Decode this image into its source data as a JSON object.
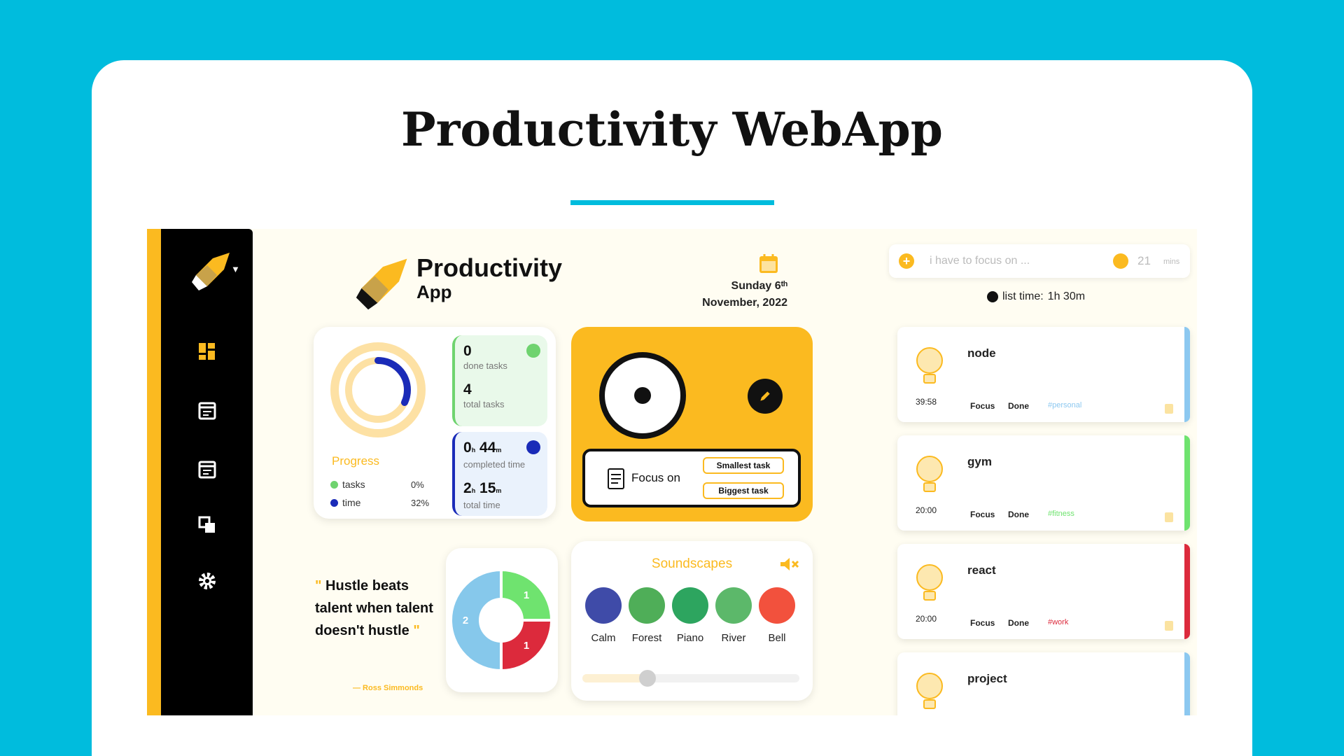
{
  "page": {
    "headline": "Productivity WebApp"
  },
  "brand": {
    "title": "Productivity",
    "subtitle": "App"
  },
  "date": {
    "line1": "Sunday 6ᵗʰ",
    "line2": "November, 2022"
  },
  "focus_bar": {
    "placeholder": "i have to focus on ...",
    "minutes": "21",
    "unit": "mins"
  },
  "list_time": {
    "label": "list time:",
    "value": "1h 30m"
  },
  "progress": {
    "title": "Progress",
    "legend": [
      {
        "label": "tasks",
        "value": "0%",
        "color": "#6FD36F"
      },
      {
        "label": "time",
        "value": "32%",
        "color": "#1A2BB8"
      }
    ],
    "time_fraction": 0.32,
    "done_tasks": {
      "value": "0",
      "label": "done tasks"
    },
    "total_tasks": {
      "value": "4",
      "label": "total tasks"
    },
    "completed_time": {
      "h": "0",
      "m": "44",
      "label": "completed time"
    },
    "total_time": {
      "h": "2",
      "m": "15",
      "label": "total time"
    }
  },
  "timer": {
    "focus_label": "Focus on",
    "smallest_label": "Smallest task",
    "biggest_label": "Biggest task"
  },
  "quote": {
    "open": "\"",
    "text": "Hustle beats talent when talent doesn't hustle",
    "close": "\"",
    "author": "— Ross Simmonds"
  },
  "pie": {
    "segments": [
      {
        "label": "1",
        "value": 1,
        "color": "#6FE36F"
      },
      {
        "label": "1",
        "value": 1,
        "color": "#DC2A3C"
      },
      {
        "label": "2",
        "value": 2,
        "color": "#86C8EB"
      }
    ]
  },
  "soundscapes": {
    "title": "Soundscapes",
    "items": [
      {
        "label": "Calm",
        "icon": "night-cloud-icon",
        "color": "#3F4BA8"
      },
      {
        "label": "Forest",
        "icon": "forest-icon",
        "color": "#4FAE58"
      },
      {
        "label": "Piano",
        "icon": "piano-icon",
        "color": "#2DA55F"
      },
      {
        "label": "River",
        "icon": "river-icon",
        "color": "#5CB86A"
      },
      {
        "label": "Bell",
        "icon": "bell-icon",
        "color": "#F2513D"
      }
    ],
    "volume": 0.3
  },
  "tasks": [
    {
      "name": "node",
      "timer": "39:58",
      "focus": "Focus",
      "done": "Done",
      "tag": "#personal",
      "tag_color": "#8CC8F0",
      "bar_color": "#8CC8F0"
    },
    {
      "name": "gym",
      "timer": "20:00",
      "focus": "Focus",
      "done": "Done",
      "tag": "#fitness",
      "tag_color": "#6FE36F",
      "bar_color": "#6FE36F"
    },
    {
      "name": "react",
      "timer": "20:00",
      "focus": "Focus",
      "done": "Done",
      "tag": "#work",
      "tag_color": "#DC2A3C",
      "bar_color": "#DC2A3C"
    },
    {
      "name": "project",
      "timer": "",
      "focus": "",
      "done": "",
      "tag": "",
      "tag_color": "#8CC8F0",
      "bar_color": "#8CC8F0"
    }
  ]
}
